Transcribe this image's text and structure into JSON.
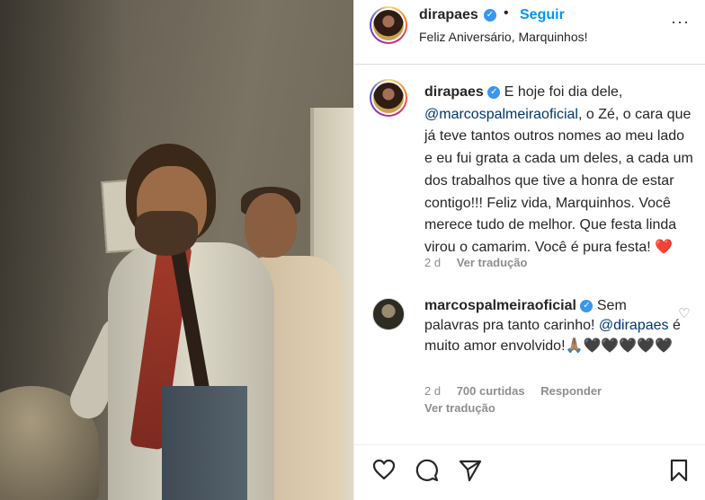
{
  "header": {
    "username": "dirapaes",
    "separator": "•",
    "follow_label": "Seguir",
    "location": "Feliz Aniversário, Marquinhos!",
    "more_label": "···"
  },
  "caption": {
    "username": "dirapaes",
    "text_before_mention": "E hoje foi dia dele,",
    "mention": "@marcospalmeiraoficial",
    "text_after_mention": ", o Zé, o cara que já teve tantos outros nomes ao meu lado e eu fui grata a cada um deles, a cada um dos trabalhos que tive a honra de estar contigo!!! Feliz vida, Marquinhos. Você merece tudo de melhor. Que festa linda virou o camarim. Você é pura festa!",
    "emoji": "❤️",
    "time": "2 d",
    "translate_label": "Ver tradução"
  },
  "comment": {
    "username": "marcospalmeiraoficial",
    "text_before_mention": "Sem palavras pra tanto carinho!",
    "mention": "@dirapaes",
    "text_after_mention": "é muito amor envolvido!",
    "emojis": "🙏🏽🖤🖤🖤🖤🖤",
    "time": "2 d",
    "likes": "700 curtidas",
    "reply_label": "Responder",
    "translate_label": "Ver tradução"
  },
  "actions": {
    "like": "heart-outline-icon",
    "comment": "comment-bubble-icon",
    "share": "paper-plane-icon",
    "save": "bookmark-icon"
  },
  "colors": {
    "link_blue": "#0095f6",
    "mention_blue": "#00376b",
    "verified_blue": "#3897f0",
    "secondary_gray": "#8e8e8e"
  }
}
